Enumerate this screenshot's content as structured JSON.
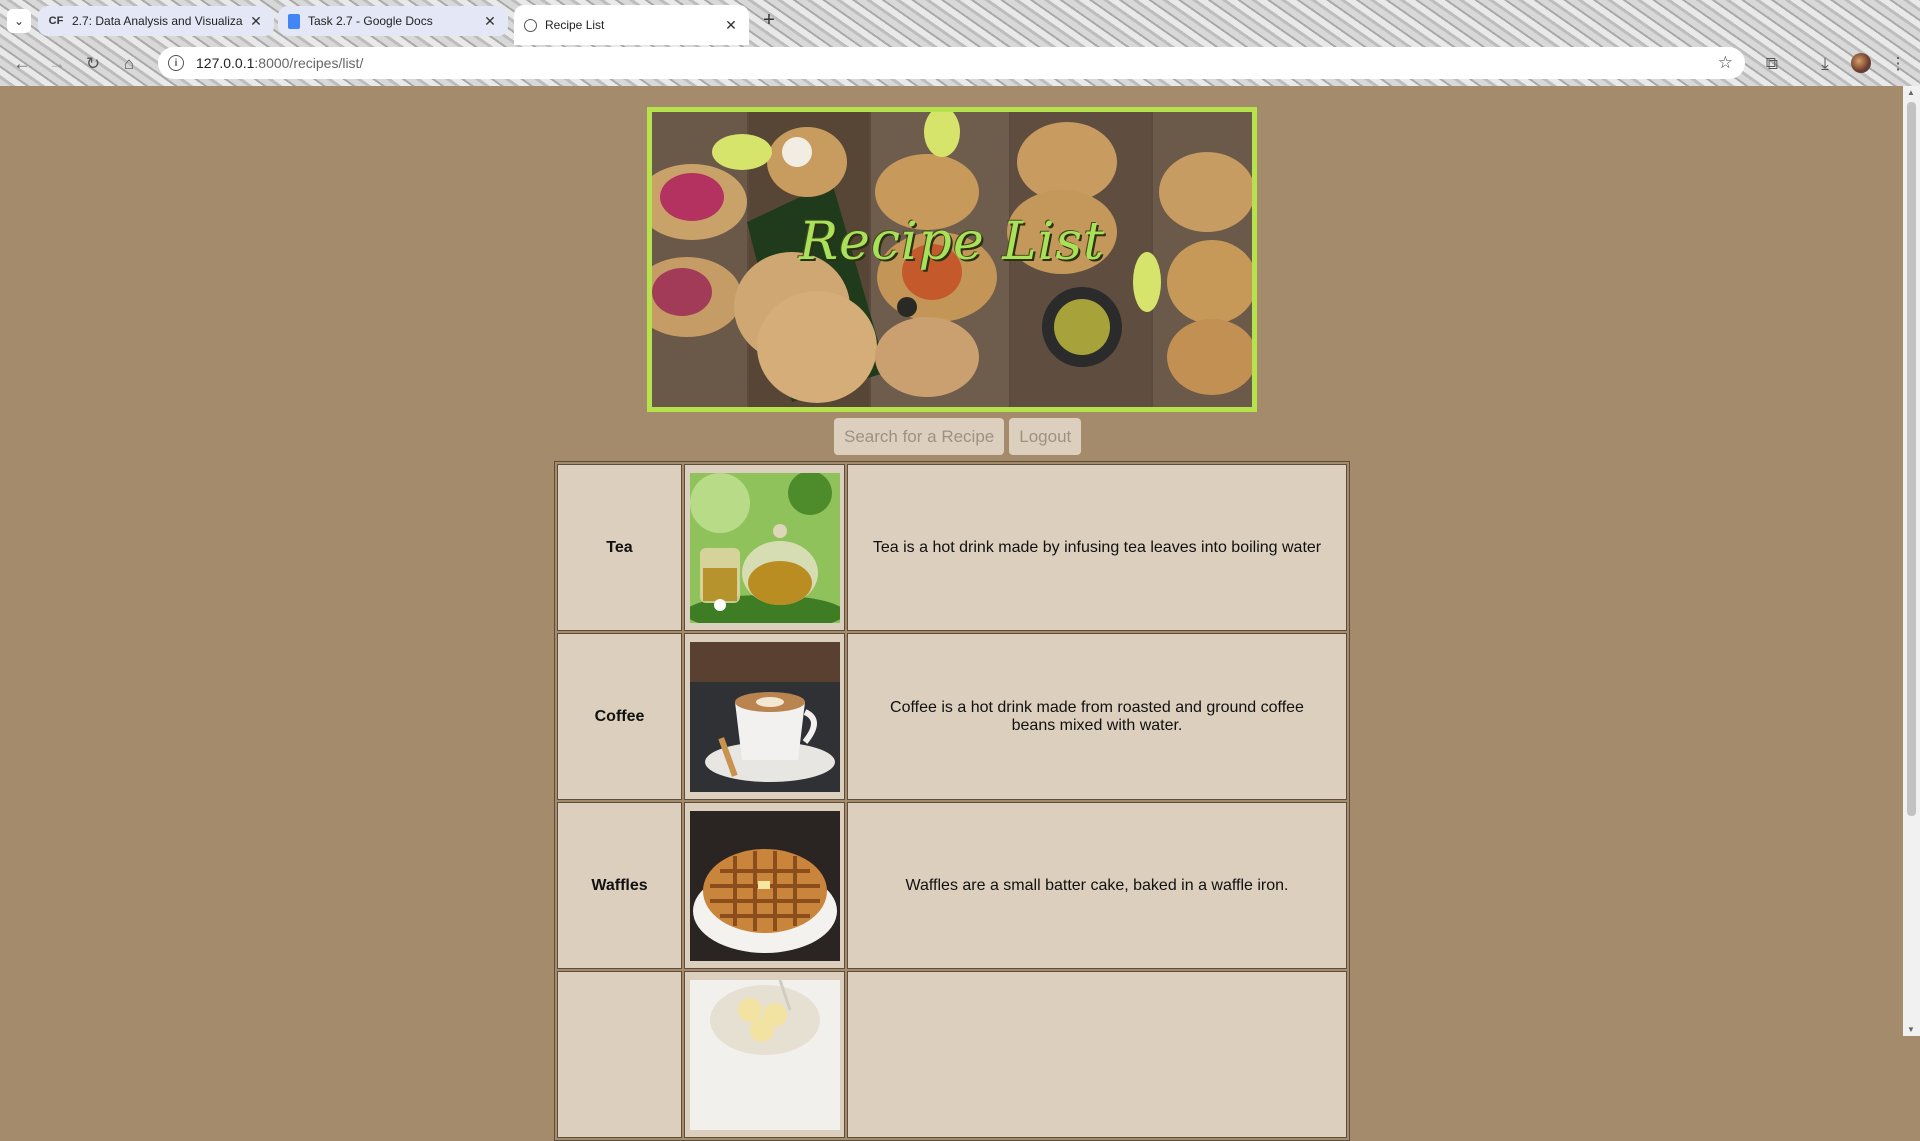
{
  "browser": {
    "tabs": [
      {
        "label": "2.7: Data Analysis and Visualiza",
        "favicon": "CF"
      },
      {
        "label": "Task 2.7 - Google Docs",
        "favicon": "docs"
      },
      {
        "label": "Recipe List",
        "favicon": "globe"
      }
    ],
    "url_host": "127.0.0.1",
    "url_path": ":8000/recipes/list/"
  },
  "page": {
    "banner_title": "Recipe List",
    "search_button": "Search for a Recipe",
    "logout_button": "Logout"
  },
  "recipes": [
    {
      "name": "Tea",
      "description": "Tea is a hot drink made by infusing tea leaves into boiling water"
    },
    {
      "name": "Coffee",
      "description": "Coffee is a hot drink made from roasted and ground coffee beans mixed with water."
    },
    {
      "name": "Waffles",
      "description": "Waffles are a small batter cake, baked in a waffle iron."
    },
    {
      "name": "",
      "description": ""
    }
  ],
  "colors": {
    "page_bg": "#a48b6b",
    "cell_bg": "#dccfbd",
    "banner_border": "#b6e34c"
  }
}
